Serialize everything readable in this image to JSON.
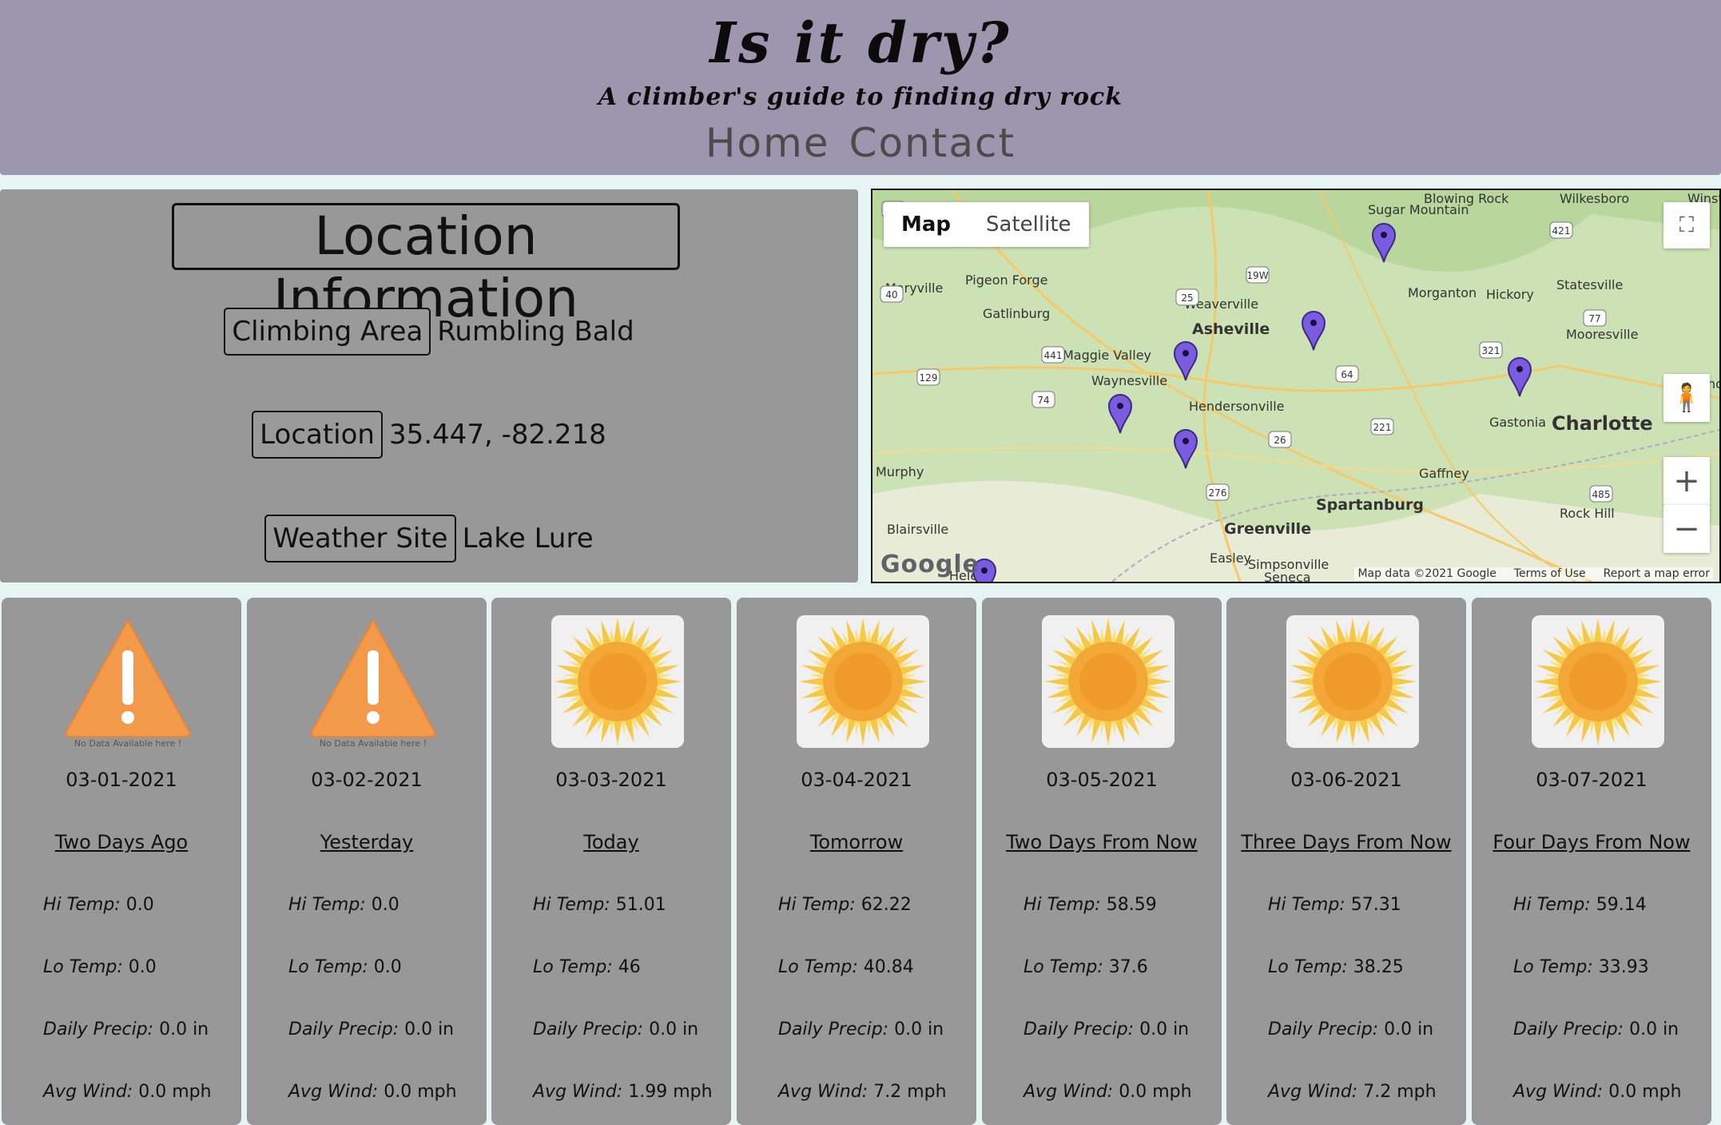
{
  "header": {
    "title": "Is it dry?",
    "subtitle": "A climber's guide to finding dry rock",
    "nav": [
      {
        "label": "Home"
      },
      {
        "label": "Contact"
      }
    ]
  },
  "location_info": {
    "title": "Location Information",
    "climbing_area_label": "Climbing Area",
    "climbing_area": "Rumbling Bald",
    "location_label": "Location",
    "location": "35.447, -82.218",
    "weather_site_label": "Weather Site",
    "weather_site": "Lake Lure"
  },
  "map": {
    "map_button": "Map",
    "satellite_button": "Satellite",
    "logo": "Google",
    "attribution": "Map data ©2021 Google",
    "terms": "Terms of Use",
    "report": "Report a map error",
    "zoom_in": "+",
    "zoom_out": "−",
    "places": [
      "Blowing Rock",
      "Wilkesboro",
      "Winsto",
      "Sugar Mountain",
      "Maryville",
      "Pigeon Forge",
      "Gatlinburg",
      "Weaverville",
      "Asheville",
      "Morganton",
      "Hickory",
      "Statesville",
      "Maggie Valley",
      "Waynesville",
      "Mooresville",
      "Hendersonville",
      "Conc",
      "Gastonia",
      "Charlotte",
      "Murphy",
      "Gaffney",
      "Spartanburg",
      "Rock Hill",
      "Blairsville",
      "Greenville",
      "Easley",
      "Simpsonville",
      "Seneca",
      "Hele"
    ],
    "route_shields": [
      "75",
      "421",
      "19W",
      "25",
      "40",
      "441",
      "129",
      "74",
      "64",
      "321",
      "77",
      "26",
      "221",
      "276",
      "485"
    ]
  },
  "forecast": {
    "labels": {
      "hi": "Hi Temp:",
      "lo": "Lo Temp:",
      "precip": "Daily Precip:",
      "wind": "Avg Wind:"
    },
    "no_data_text": "No Data Available here !",
    "days": [
      {
        "date": "03-01-2021",
        "day": "Two Days Ago",
        "icon": "warning-icon",
        "hi": "0.0",
        "lo": "0.0",
        "precip": "0.0 in",
        "wind": "0.0 mph"
      },
      {
        "date": "03-02-2021",
        "day": "Yesterday",
        "icon": "warning-icon",
        "hi": "0.0",
        "lo": "0.0",
        "precip": "0.0 in",
        "wind": "0.0 mph"
      },
      {
        "date": "03-03-2021",
        "day": "Today",
        "icon": "sun-icon",
        "hi": "51.01",
        "lo": "46",
        "precip": "0.0 in",
        "wind": "1.99 mph"
      },
      {
        "date": "03-04-2021",
        "day": "Tomorrow",
        "icon": "sun-icon",
        "hi": "62.22",
        "lo": "40.84",
        "precip": "0.0 in",
        "wind": "7.2 mph"
      },
      {
        "date": "03-05-2021",
        "day": "Two Days From Now",
        "icon": "sun-icon",
        "hi": "58.59",
        "lo": "37.6",
        "precip": "0.0 in",
        "wind": "0.0 mph"
      },
      {
        "date": "03-06-2021",
        "day": "Three Days From Now",
        "icon": "sun-icon",
        "hi": "57.31",
        "lo": "38.25",
        "precip": "0.0 in",
        "wind": "7.2 mph"
      },
      {
        "date": "03-07-2021",
        "day": "Four Days From Now",
        "icon": "sun-icon",
        "hi": "59.14",
        "lo": "33.93",
        "precip": "0.0 in",
        "wind": "0.0 mph"
      }
    ]
  },
  "colors": {
    "header_bg": "#9c97ae",
    "panel_bg": "#989898",
    "page_bg": "#e6f4f4",
    "marker": "#7b5ce0"
  }
}
